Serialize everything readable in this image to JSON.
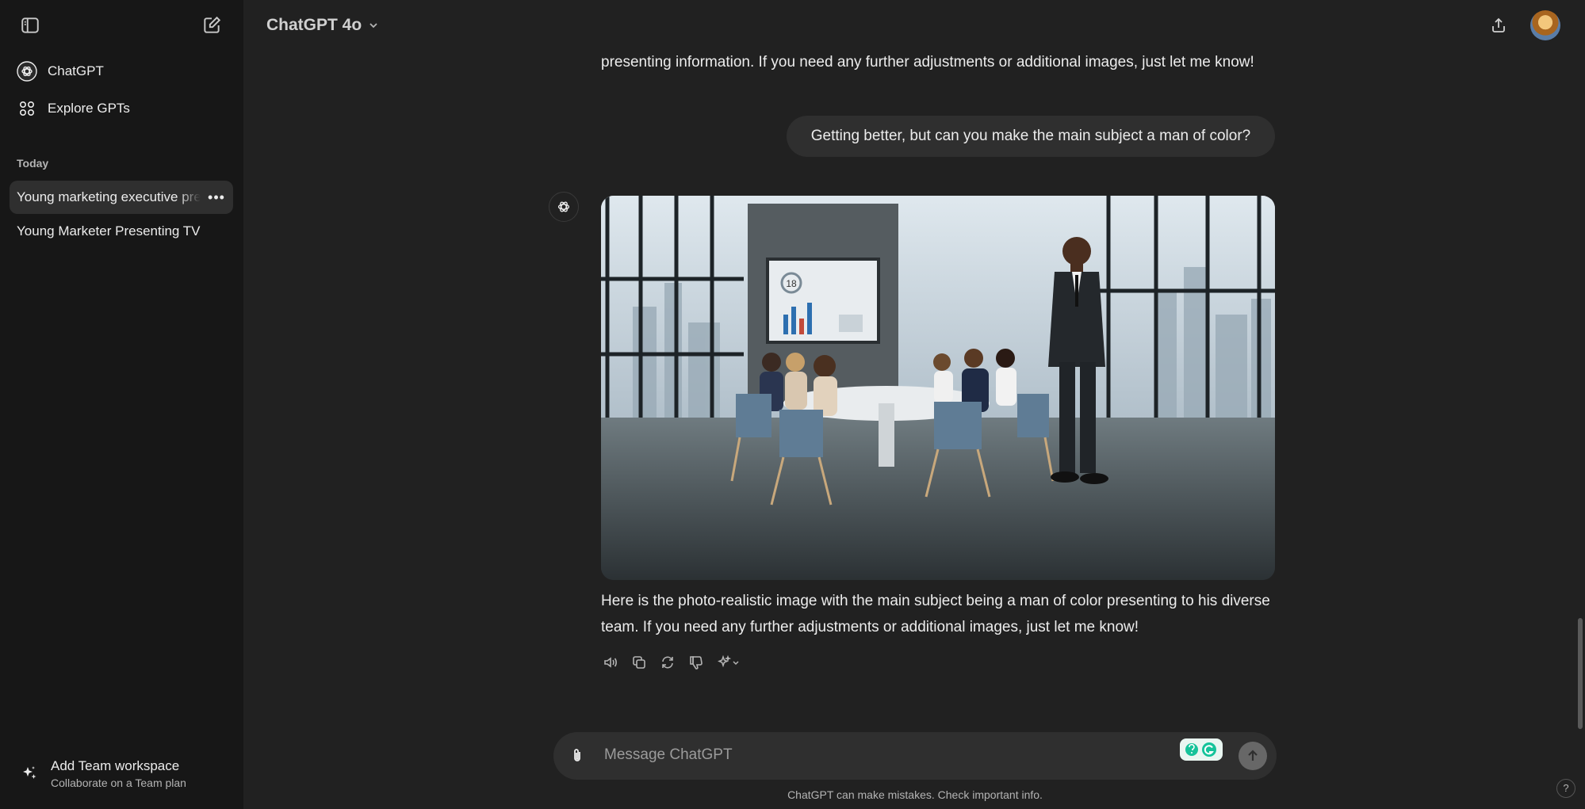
{
  "sidebar": {
    "nav": [
      {
        "label": "ChatGPT",
        "icon": "openai-logo-icon"
      },
      {
        "label": "Explore GPTs",
        "icon": "grid-icon"
      }
    ],
    "section_label": "Today",
    "chats": [
      {
        "title": "Young marketing executive presenting",
        "active": true
      },
      {
        "title": "Young Marketer Presenting TV",
        "active": false
      }
    ],
    "more_label": "•••",
    "team": {
      "title": "Add Team workspace",
      "subtitle": "Collaborate on a Team plan"
    }
  },
  "header": {
    "model": "ChatGPT 4o"
  },
  "conversation": {
    "prev_assistant_tail": "presenting information. If you need any further adjustments or additional images, just let me know!",
    "user_message": "Getting better, but can you make the main subject a man of color?",
    "assistant_message": "Here is the photo-realistic image with the main subject being a man of color presenting to his diverse team. If you need any further adjustments or additional images, just let me know!",
    "image_chart_label": "18"
  },
  "composer": {
    "placeholder": "Message ChatGPT"
  },
  "footer": {
    "disclaimer": "ChatGPT can make mistakes. Check important info.",
    "help": "?"
  },
  "colors": {
    "background": "#212121",
    "sidebar": "#171717",
    "bubble": "#2f2f2f",
    "text": "#ececec",
    "muted": "#b4b4b4"
  }
}
